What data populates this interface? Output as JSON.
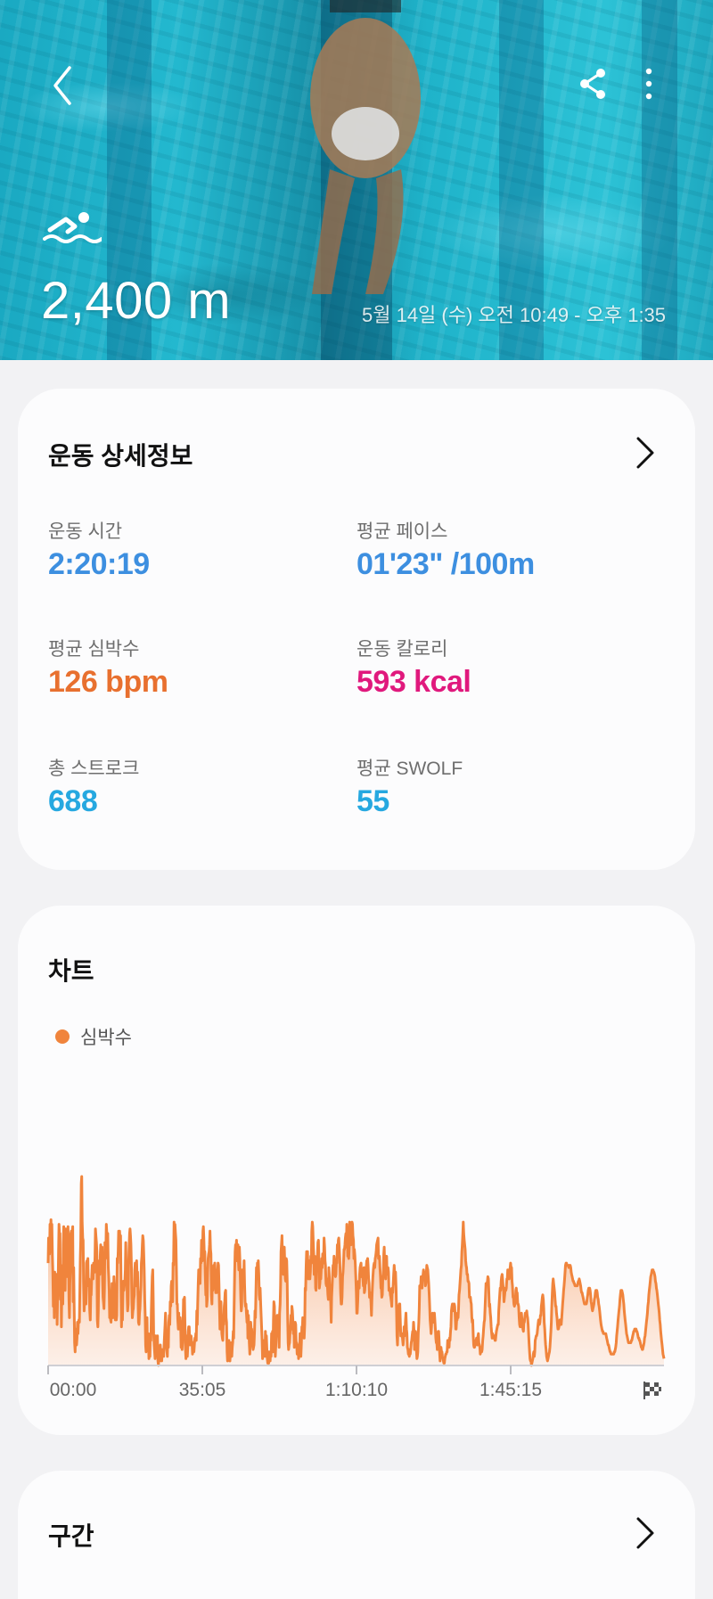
{
  "hero": {
    "distance": "2,400 m",
    "date_range": "5월 14일 (수) 오전 10:49 - 오후 1:35",
    "icons": {
      "back": "back-arrow-icon",
      "share": "share-icon",
      "more": "more-vertical-icon",
      "activity": "swimming-icon"
    }
  },
  "details": {
    "title": "운동 상세정보",
    "stats": [
      {
        "label": "운동 시간",
        "value": "2:20:19",
        "color": "#3d8fe0"
      },
      {
        "label": "평균 페이스",
        "value": "01'23\" /100m",
        "color": "#3d8fe0"
      },
      {
        "label": "평균 심박수",
        "value": "126 bpm",
        "color": "#e8702f"
      },
      {
        "label": "운동 칼로리",
        "value": "593 kcal",
        "color": "#e0197d"
      },
      {
        "label": "총 스트로크",
        "value": "688",
        "color": "#26a8e0"
      },
      {
        "label": "평균 SWOLF",
        "value": "55",
        "color": "#26a8e0"
      }
    ]
  },
  "chart": {
    "title": "차트",
    "legend": "심박수",
    "accent": "#f0843c"
  },
  "chart_data": {
    "type": "area",
    "series": [
      {
        "name": "심박수",
        "values": [
          45,
          56,
          55,
          49,
          62,
          60,
          64,
          50,
          62,
          48,
          41,
          26,
          36,
          21,
          41,
          36,
          31,
          34,
          40,
          18,
          29,
          35,
          50,
          62,
          58,
          58,
          29,
          44,
          17,
          34,
          36,
          27,
          53,
          61,
          57,
          42,
          33,
          60,
          59,
          55,
          42,
          39,
          61,
          52,
          29,
          21,
          36,
          42,
          58,
          59,
          54,
          59,
          61,
          28,
          43,
          26,
          10,
          6,
          16,
          12,
          9,
          12,
          19,
          14,
          19,
          20,
          19,
          33,
          47,
          55,
          80,
          83,
          63,
          56,
          55,
          36,
          24,
          29,
          27,
          33,
          27,
          45,
          46,
          38,
          47,
          35,
          38,
          32,
          24,
          20,
          31,
          31,
          39,
          44,
          40,
          38,
          45,
          44,
          41,
          48,
          60,
          57,
          54,
          50,
          20,
          17,
          24,
          41,
          46,
          40,
          48,
          53,
          45,
          43,
          52,
          38,
          30,
          28,
          25,
          34,
          54,
          47,
          51,
          62,
          58,
          53,
          58,
          43,
          39,
          33,
          21,
          25,
          20,
          19,
          28,
          36,
          27,
          21,
          23,
          39,
          35,
          28,
          20,
          20,
          20,
          22,
          47,
          45,
          50,
          59,
          54,
          59,
          55,
          57,
          36,
          17,
          25,
          20,
          31,
          37,
          33,
          35,
          36,
          42,
          54,
          43,
          44,
          30,
          24,
          27,
          44,
          51,
          58,
          60,
          57,
          53,
          43,
          28,
          21,
          24,
          25,
          29,
          31,
          42,
          45,
          37,
          35,
          46,
          38,
          41,
          29,
          19,
          18,
          23,
          25,
          31,
          35,
          45,
          48,
          53,
          57,
          55,
          49,
          42,
          29,
          22,
          9,
          6,
          13,
          21,
          7,
          14,
          10,
          3,
          8,
          4,
          14,
          11,
          24,
          32,
          39,
          42,
          30,
          14,
          9,
          6,
          3,
          13,
          8,
          7,
          4,
          13,
          2,
          0,
          6,
          4,
          2,
          9,
          5,
          4,
          2,
          7,
          4,
          4,
          4,
          9,
          14,
          18,
          23,
          15,
          8,
          6,
          4,
          15,
          8,
          19,
          22,
          18,
          28,
          26,
          35,
          37,
          30,
          28,
          45,
          44,
          63,
          59,
          62,
          58,
          55,
          43,
          27,
          27,
          20,
          16,
          23,
          16,
          16,
          21,
          18,
          8,
          11,
          7,
          10,
          19,
          29,
          28,
          30,
          19,
          8,
          3,
          13,
          10,
          4,
          8,
          15,
          17,
          17,
          11,
          9,
          12,
          13,
          11,
          10,
          5,
          9,
          8,
          6,
          9,
          12,
          11,
          14,
          11,
          24,
          18,
          27,
          36,
          42,
          41,
          40,
          36,
          47,
          45,
          55,
          52,
          46,
          59,
          61,
          56,
          48,
          50,
          40,
          31,
          38,
          26,
          29,
          41,
          47,
          49,
          50,
          53,
          59,
          51,
          49,
          31,
          27,
          38,
          33,
          38,
          44,
          41,
          45,
          41,
          32,
          38,
          32,
          37,
          40,
          45,
          44,
          36,
          25,
          16,
          19,
          28,
          21,
          14,
          12,
          11,
          19,
          18,
          26,
          28,
          32,
          33,
          21,
          19,
          6,
          2,
          8,
          4,
          11,
          7,
          2,
          6,
          10,
          5,
          4,
          8,
          10,
          15,
          12,
          26,
          41,
          50,
          53,
          52,
          55,
          46,
          47,
          53,
          46,
          42,
          52,
          47,
          39,
          29,
          24,
          26,
          42,
          38,
          42,
          39,
          46,
          36,
          28,
          26,
          27,
          23,
          19,
          24,
          12,
          22,
          17,
          10,
          5,
          10,
          19,
          16,
          16,
          13,
          9,
          7,
          8,
          9,
          15,
          24,
          21,
          33,
          43,
          38,
          45,
          41,
          46,
          40,
          31,
          29,
          34,
          27,
          22,
          17,
          11,
          3,
          11,
          10,
          5,
          11,
          4,
          15,
          7,
          13,
          8,
          3,
          1,
          6,
          1,
          6,
          5,
          2,
          6,
          4,
          14,
          7,
          15,
          6,
          20,
          28,
          26,
          11,
          4,
          9,
          14,
          18,
          22,
          21,
          22,
          15,
          8,
          23,
          27,
          35,
          50,
          53,
          57,
          48,
          50,
          40,
          51,
          52,
          44,
          38,
          37,
          47,
          46,
          38,
          20,
          10,
          7,
          9,
          10,
          14,
          17,
          22,
          16,
          26,
          24,
          20,
          14,
          17,
          8,
          14,
          19,
          18,
          10,
          10,
          5,
          8,
          9,
          3,
          7,
          6,
          14,
          8,
          4,
          10,
          17,
          16,
          21,
          15,
          18,
          12,
          18,
          34,
          33,
          44,
          50,
          45,
          50,
          41,
          38,
          42,
          46,
          38,
          41,
          48,
          45,
          59,
          63,
          61,
          55,
          49,
          40,
          48,
          47,
          34,
          33,
          45,
          48,
          48,
          54,
          55,
          47,
          34,
          36,
          40,
          38,
          43,
          47,
          43,
          49,
          45,
          46,
          56,
          52,
          46,
          44,
          36,
          35,
          38,
          35,
          31,
          29,
          43,
          39,
          32,
          32,
          27,
          19,
          30,
          35,
          40,
          44,
          43,
          48,
          46,
          40,
          39,
          40,
          46,
          45,
          53,
          48,
          55,
          56,
          52,
          47,
          40,
          32,
          27,
          27,
          30,
          39,
          41,
          45,
          51,
          51,
          53,
          56,
          58,
          52,
          62,
          56,
          48,
          53,
          47,
          52,
          63,
          61,
          56,
          53,
          58,
          63,
          62,
          57,
          55,
          47,
          51,
          48,
          44,
          39,
          32,
          23,
          23,
          28,
          34,
          37,
          34,
          40,
          43,
          44,
          45,
          39,
          42,
          40,
          38,
          35,
          43,
          32,
          33,
          37,
          36,
          43,
          46,
          44,
          47,
          44,
          38,
          36,
          30,
          32,
          31,
          28,
          22,
          29,
          34,
          39,
          42,
          44,
          45,
          43,
          47,
          48,
          50,
          53,
          54,
          55,
          56,
          47,
          47,
          48,
          43,
          39,
          34,
          34,
          30,
          31,
          38,
          40,
          49,
          52,
          45,
          40,
          38,
          47,
          48,
          40,
          42,
          43,
          41,
          33,
          34,
          33,
          31,
          30,
          28,
          26,
          34,
          32,
          36,
          40,
          44,
          41,
          36,
          41,
          34,
          25,
          13,
          9,
          16,
          19,
          26,
          27,
          27,
          19,
          13,
          14,
          14,
          13,
          11,
          9,
          12,
          17,
          13,
          16,
          20,
          23,
          16,
          14,
          8,
          7,
          5,
          5,
          4,
          7,
          5,
          7,
          10,
          11,
          13,
          15,
          14,
          19,
          15,
          7,
          11,
          15,
          13,
          7,
          3,
          4,
          6,
          14,
          19,
          25,
          35,
          35,
          35,
          39,
          35,
          34,
          38,
          40,
          42,
          40,
          41,
          39,
          35,
          36,
          41,
          44,
          43,
          42,
          39,
          36,
          31,
          26,
          20,
          17,
          14,
          17,
          22,
          23,
          21,
          19,
          21,
          23,
          20,
          16,
          12,
          10,
          10,
          7,
          14,
          15,
          15,
          11,
          6,
          2,
          6,
          8,
          6,
          6,
          4,
          3,
          2,
          1,
          1,
          3,
          4,
          5,
          5,
          6,
          6,
          11,
          11,
          9,
          8,
          12,
          11,
          15,
          17,
          24,
          26,
          27,
          24,
          25,
          27,
          27,
          26,
          21,
          16,
          16,
          20,
          20,
          23,
          21,
          25,
          31,
          33,
          36,
          39,
          42,
          44,
          50,
          53,
          58,
          63,
          58,
          55,
          53,
          51,
          46,
          44,
          43,
          40,
          40,
          37,
          37,
          36,
          30,
          30,
          30,
          28,
          27,
          21,
          19,
          20,
          13,
          9,
          8,
          8,
          9,
          10,
          11,
          12,
          10,
          9,
          13,
          14,
          10,
          9,
          8,
          5,
          6,
          6,
          6,
          7,
          11,
          13,
          16,
          19,
          20,
          25,
          31,
          36,
          36,
          36,
          37,
          39,
          38,
          32,
          26,
          27,
          23,
          21,
          17,
          14,
          12,
          14,
          12,
          12,
          13,
          13,
          11,
          11,
          13,
          15,
          16,
          17,
          18,
          18,
          24,
          28,
          31,
          34,
          33,
          37,
          39,
          40,
          38,
          35,
          34,
          28,
          30,
          32,
          34,
          33,
          34,
          38,
          38,
          42,
          40,
          39,
          38,
          42,
          43,
          45,
          43,
          43,
          37,
          35,
          30,
          30,
          27,
          26,
          27,
          28,
          33,
          34,
          31,
          32,
          27,
          27,
          26,
          21,
          18,
          17,
          17,
          21,
          23,
          20,
          19,
          16,
          15,
          19,
          19,
          21,
          23,
          23,
          22,
          24,
          22,
          21,
          18,
          14,
          10,
          6,
          3,
          2,
          2,
          0,
          1,
          2,
          3,
          5,
          6,
          4,
          6,
          11,
          12,
          13,
          13,
          14,
          16,
          18,
          20,
          19,
          18,
          19,
          22,
          22,
          26,
          28,
          30,
          31,
          29,
          25,
          19,
          16,
          12,
          9,
          7,
          4,
          3,
          2,
          3,
          4,
          5,
          6,
          8,
          11,
          15,
          19,
          26,
          32,
          36,
          38,
          36,
          34,
          32,
          29,
          26,
          26,
          23,
          21,
          18,
          16,
          16,
          17,
          18,
          20,
          20,
          18,
          18,
          21,
          24,
          27,
          30,
          33,
          35,
          38,
          41,
          44,
          45,
          45,
          44,
          44,
          44,
          44,
          43,
          44,
          44,
          44,
          43,
          41,
          40,
          39,
          38,
          37,
          37,
          36,
          36,
          35,
          35,
          35,
          35,
          35,
          35,
          36,
          37,
          37,
          38,
          37,
          36,
          35,
          33,
          32,
          32,
          31,
          30,
          29,
          28,
          27,
          27,
          27,
          27,
          27,
          28,
          30,
          31,
          33,
          34,
          34,
          34,
          33,
          31,
          28,
          27,
          25,
          24,
          25,
          26,
          27,
          29,
          30,
          32,
          33,
          33,
          33,
          32,
          30,
          29,
          27,
          26,
          24,
          22,
          20,
          18,
          17,
          16,
          15,
          15,
          14,
          14,
          14,
          14,
          14,
          14,
          13,
          12,
          11,
          10,
          9,
          9,
          8,
          7,
          6,
          6,
          5,
          5,
          5,
          5,
          5,
          5,
          5,
          6,
          6,
          7,
          8,
          10,
          13,
          15,
          17,
          20,
          22,
          24,
          26,
          29,
          31,
          33,
          33,
          33,
          32,
          31,
          29,
          27,
          24,
          22,
          20,
          18,
          16,
          14,
          13,
          12,
          11,
          10,
          10,
          10,
          10,
          10,
          10,
          11,
          11,
          12,
          13,
          14,
          15,
          15,
          16,
          16,
          16,
          16,
          15,
          15,
          14,
          13,
          12,
          12,
          11,
          11,
          10,
          9,
          8,
          8,
          7,
          7,
          8,
          9,
          10,
          12,
          13,
          15,
          17,
          19,
          21,
          23,
          26,
          28,
          31,
          33,
          35,
          37,
          39,
          40,
          41,
          42,
          42,
          42,
          41,
          41,
          40,
          39,
          37,
          36,
          34,
          33,
          31,
          29,
          27,
          25,
          23,
          20,
          18,
          15,
          13,
          11,
          9,
          7,
          5,
          4,
          3
        ]
      }
    ],
    "x_ticks": [
      "00:00",
      "35:05",
      "1:10:10",
      "1:45:15"
    ],
    "x_range_minutes": [
      0,
      140.3
    ],
    "finish_icon": "checkered-flag-icon",
    "grid": false
  },
  "intervals": {
    "title": "구간"
  }
}
